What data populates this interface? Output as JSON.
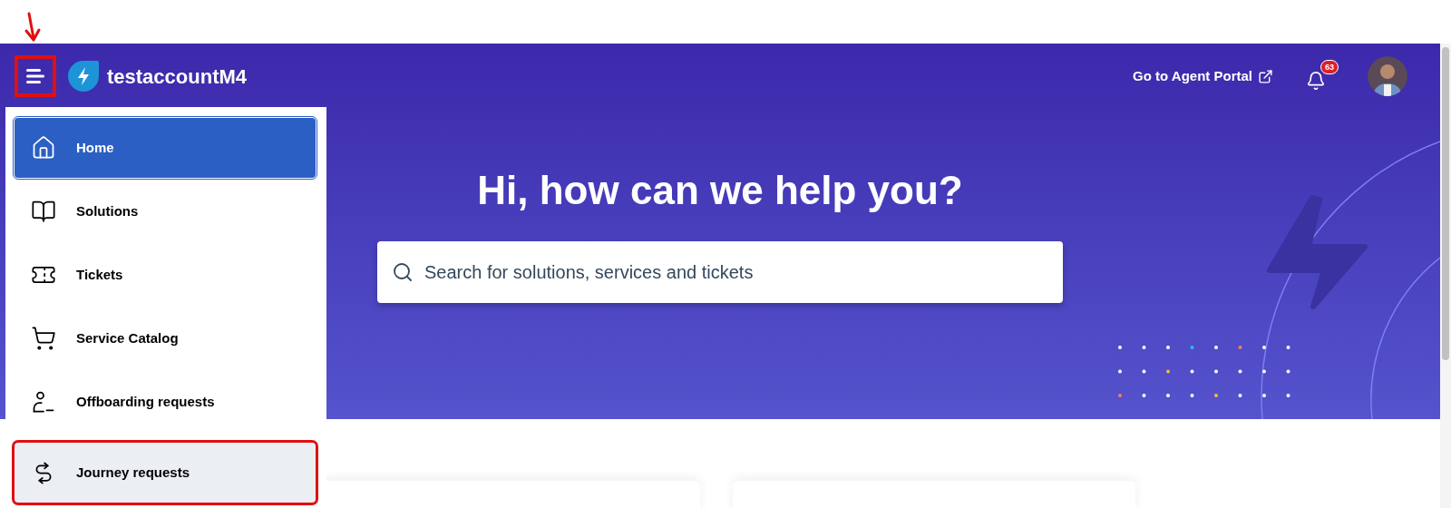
{
  "header": {
    "menu_annotated": true,
    "brand": "testaccountM4",
    "agent_portal_link": "Go to Agent Portal",
    "notification_count": "63"
  },
  "sidebar": {
    "items": [
      {
        "label": "Home",
        "selected": true,
        "hovered": false,
        "annotated": false
      },
      {
        "label": "Solutions",
        "selected": false,
        "hovered": false,
        "annotated": false
      },
      {
        "label": "Tickets",
        "selected": false,
        "hovered": false,
        "annotated": false
      },
      {
        "label": "Service Catalog",
        "selected": false,
        "hovered": false,
        "annotated": false
      },
      {
        "label": "Offboarding requests",
        "selected": false,
        "hovered": false,
        "annotated": false
      },
      {
        "label": "Journey requests",
        "selected": false,
        "hovered": true,
        "annotated": true
      }
    ]
  },
  "hero": {
    "title": "Hi, how can we help you?",
    "search": {
      "placeholder": "Search for solutions, services and tickets"
    }
  }
}
